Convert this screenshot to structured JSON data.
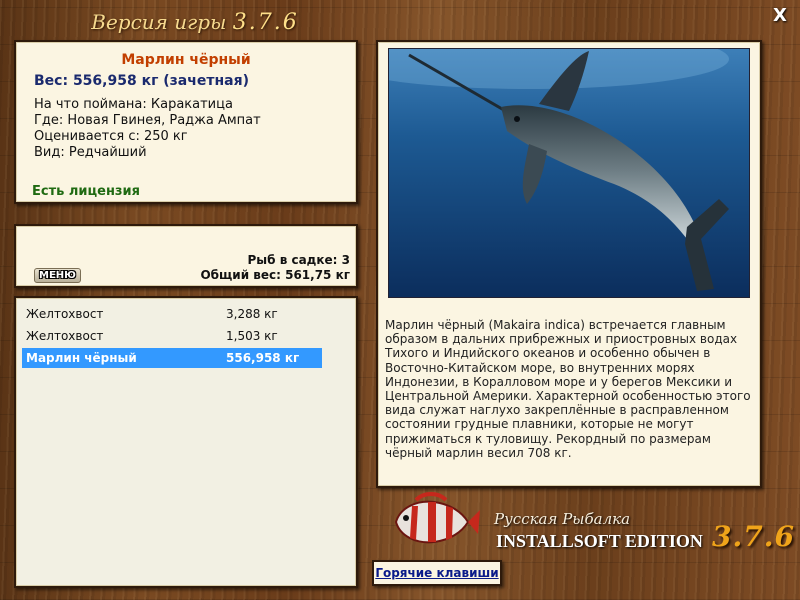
{
  "header": {
    "title": "Версия игры",
    "version": "3.7.6",
    "close_label": "X"
  },
  "fish_info": {
    "name": "Марлин чёрный",
    "weight": "Вес: 556,958 кг (зачетная)",
    "bait": "На что поймана: Каракатица",
    "location": "Где: Новая Гвинея, Раджа Ампат",
    "valued_from": "Оценивается с: 250 кг",
    "rarity": "Вид: Редчайший",
    "license": "Есть лицензия"
  },
  "stats": {
    "menu_label": "МЕНЮ",
    "fish_count": "Рыб в садке: 3",
    "total_weight": "Общий вес: 561,75 кг"
  },
  "catch_list": [
    {
      "name": "Желтохвост",
      "weight": "3,288 кг",
      "selected": false
    },
    {
      "name": "Желтохвост",
      "weight": "1,503 кг",
      "selected": false
    },
    {
      "name": "Марлин чёрный",
      "weight": "556,958 кг",
      "selected": true
    }
  ],
  "description": "Марлин чёрный (Makaira indica) встречается главным образом в дальних прибрежных и приостровных водах Тихого и Индийского океанов и особенно обычен в Восточно-Китайском море, во внутренних морях Индонезии, в Коралловом море и у берегов Мексики и Центральной Америки. Характерной особенностью этого вида служат наглухо закреплённые в расправленном состоянии грудные плавники, которые не могут прижиматься к туловищу. Рекордный по размерам чёрный марлин весил 708 кг.",
  "branding": {
    "title_ru": "Русская Рыбалка",
    "edition": "INSTALLSOFT EDITION",
    "version": "3.7.6"
  },
  "hotkeys_label": "Горячие клавиши",
  "colors": {
    "accent_name": "#c23f00",
    "weight_text": "#1a2a6e",
    "license_text": "#1f6a12",
    "selection": "#3399ff",
    "link": "#0a1a8a",
    "brand_version": "#f0a41a"
  },
  "icons": {
    "close": "close-icon",
    "logo": "red-fish-logo-icon"
  }
}
